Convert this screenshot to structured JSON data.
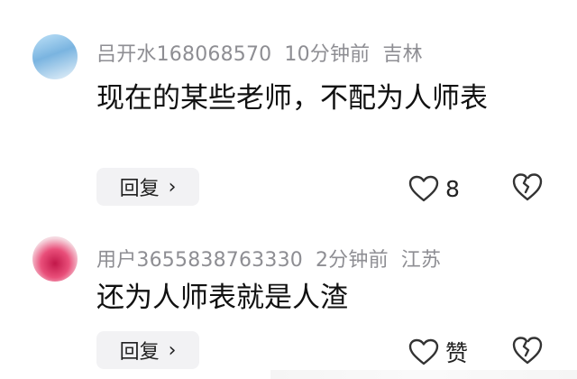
{
  "comments": [
    {
      "username": "吕开水168068570",
      "time": "10分钟前",
      "location": "吉林",
      "text": "现在的某些老师，不配为人师表",
      "reply_label": "回复",
      "like_count": "8"
    },
    {
      "username": "用户3655838763330",
      "time": "2分钟前",
      "location": "江苏",
      "text": "还为人师表就是人渣",
      "reply_label": "回复",
      "like_label": "赞"
    }
  ]
}
